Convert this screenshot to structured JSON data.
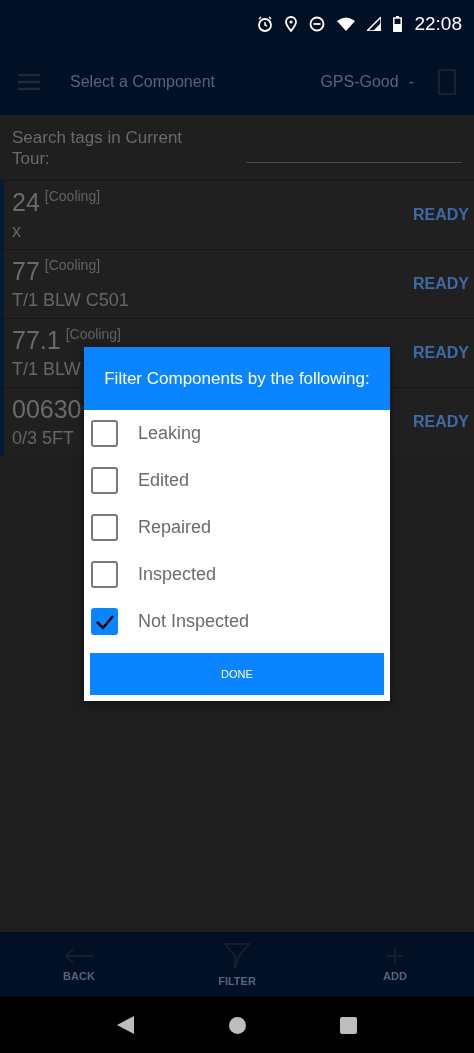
{
  "status_bar": {
    "time": "22:08"
  },
  "toolbar": {
    "title": "Select a Component",
    "gps": "GPS-Good",
    "gps_suffix": "-"
  },
  "search": {
    "label": "Search tags in Current Tour:"
  },
  "components": [
    {
      "tag": "24",
      "category": "[Cooling]",
      "description": "x",
      "status": "READY"
    },
    {
      "tag": "77",
      "category": "[Cooling]",
      "description": "T/1 BLW C501",
      "status": "READY"
    },
    {
      "tag": "77.1",
      "category": "[Cooling]",
      "description": "T/1 BLW",
      "status": "READY"
    },
    {
      "tag": "00630",
      "description": "0/3 5FT",
      "status": "READY"
    }
  ],
  "dialog": {
    "title": "Filter Components by the following:",
    "options": [
      {
        "label": "Leaking",
        "checked": false
      },
      {
        "label": "Edited",
        "checked": false
      },
      {
        "label": "Repaired",
        "checked": false
      },
      {
        "label": "Inspected",
        "checked": false
      },
      {
        "label": "Not Inspected",
        "checked": true
      }
    ],
    "button": "DONE"
  },
  "bottom_nav": [
    {
      "kind": "back",
      "label": "BACK"
    },
    {
      "kind": "filter",
      "label": "FILTER"
    },
    {
      "kind": "add",
      "label": "ADD"
    }
  ]
}
